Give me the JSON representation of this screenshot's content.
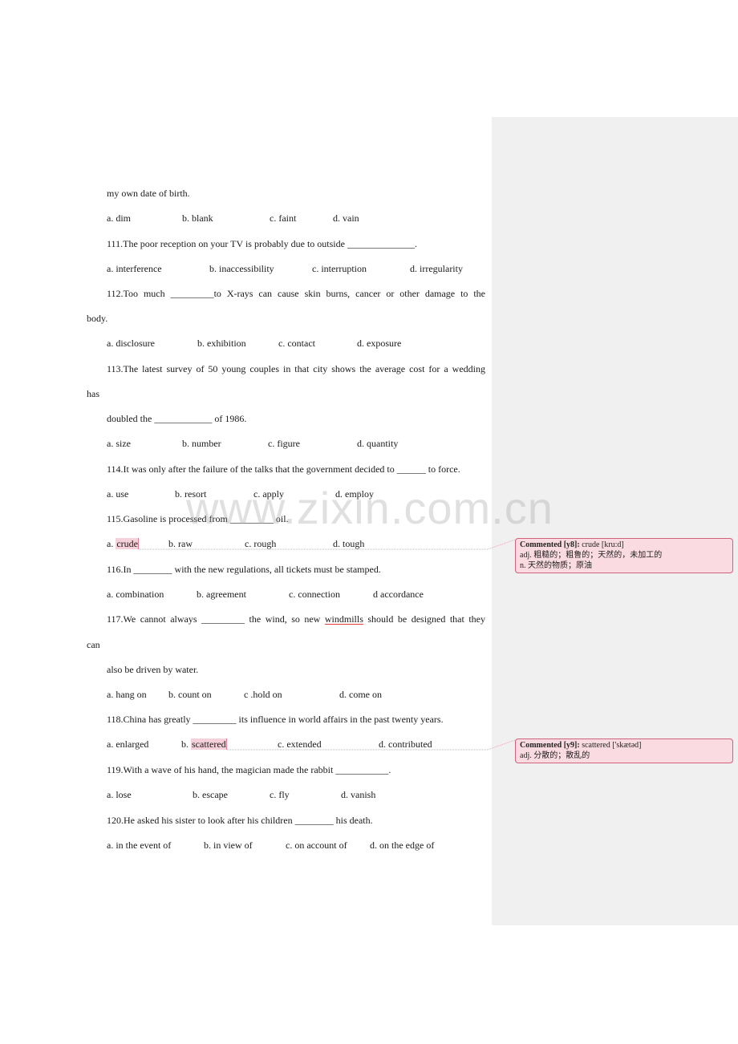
{
  "document": {
    "lines": {
      "l1": "my own date of birth.",
      "q110_opts": [
        "a. dim",
        "b. blank",
        "c. faint",
        "d. vain"
      ],
      "q111": "111.The poor reception on your TV is probably due to outside ______________.",
      "q111_opts": [
        "a. interference",
        "b. inaccessibility",
        "c. interruption",
        "d. irregularity"
      ],
      "q112a": "112.Too much _________to X-rays can cause skin burns, cancer or other damage to the",
      "q112b": "body.",
      "q112_opts": [
        "a. disclosure",
        "b. exhibition",
        "c. contact",
        "d. exposure"
      ],
      "q113a": "113.The latest survey of 50 young couples in that city shows the average cost for a wedding",
      "q113b": "has",
      "q113c": "doubled the ____________ of 1986.",
      "q113_opts": [
        "a. size",
        "b. number",
        "c. figure",
        "d. quantity"
      ],
      "q114": "114.It was only after the failure of the talks that the government decided to ______ to force.",
      "q114_opts": [
        "a. use",
        "b. resort",
        "c. apply",
        "d. employ"
      ],
      "q115": "115.Gasoline is processed from _________ oil.",
      "q115_opts": [
        "a. ",
        "crude",
        "b. raw",
        "c. rough",
        "d. tough"
      ],
      "q116": "116.In ________ with the new regulations, all tickets must be stamped.",
      "q116_opts": [
        "a. combination",
        "b. agreement",
        "c. connection",
        "d accordance"
      ],
      "q117a_pre": "117.We cannot always _________ the wind, so new ",
      "q117a_word": "windmills",
      "q117a_post": " should be designed that they",
      "q117b": "can",
      "q117c": "also be driven by water.",
      "q117_opts": [
        "a. hang on",
        "b. count on",
        "c .hold on",
        "d. come on"
      ],
      "q118": "118.China has greatly _________ its influence in world affairs in the past twenty years.",
      "q118_opts": [
        "a. enlarged",
        "b. ",
        "scattered",
        "c. extended",
        "d. contributed"
      ],
      "q119": "119.With a wave of his hand, the magician made the rabbit ___________.",
      "q119_opts": [
        "a. lose",
        "b. escape",
        "c. fly",
        "d. vanish"
      ],
      "q120": "120.He asked his sister to look after his children ________ his death.",
      "q120_opts": [
        "a. in the event of",
        "b. in view of",
        "c. on account of",
        "d. on the edge of"
      ]
    }
  },
  "watermark": "www.zixin.com.cn",
  "comments": [
    {
      "label": "Commented [y8]:",
      "head": " crude [kru:d]",
      "lines": [
        "adj. 粗糙的；粗鲁的；天然的，未加工的",
        "n. 天然的物质；原油"
      ]
    },
    {
      "label": "Commented [y9]:",
      "head": " scattered ['skætəd]",
      "lines": [
        "adj. 分散的；散乱的"
      ]
    }
  ],
  "colors": {
    "comment_bg": "#fadbe2",
    "comment_border": "#d2617b",
    "highlight": "#f6d0da",
    "pane_bg": "#f0f0f0"
  }
}
